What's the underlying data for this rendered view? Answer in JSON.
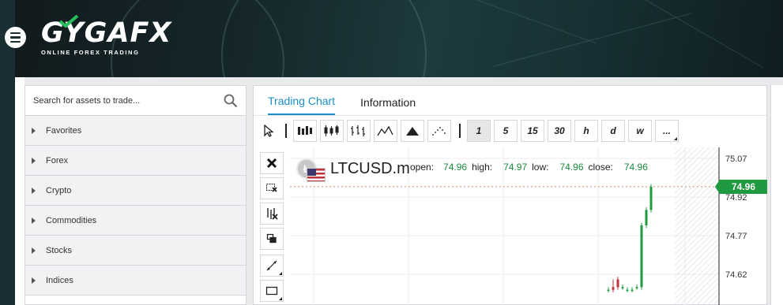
{
  "brand": {
    "name_part1": "GYGA",
    "name_part2": "FX",
    "tagline": "ONLINE FOREX TRADING"
  },
  "search": {
    "placeholder": "Search for assets to trade..."
  },
  "categories": [
    {
      "label": "Favorites"
    },
    {
      "label": "Forex"
    },
    {
      "label": "Crypto"
    },
    {
      "label": "Commodities"
    },
    {
      "label": "Stocks"
    },
    {
      "label": "Indices"
    }
  ],
  "tabs": [
    {
      "label": "Trading Chart",
      "active": true
    },
    {
      "label": "Information",
      "active": false
    }
  ],
  "toolbar": {
    "chart_types": [
      "bars-icon",
      "candles-icon",
      "hollow-candles-icon",
      "line-icon",
      "area-icon",
      "dots-icon"
    ],
    "timeframes": [
      "1",
      "5",
      "15",
      "30",
      "h",
      "d",
      "w",
      "..."
    ],
    "selected_timeframe": "1"
  },
  "left_tools": [
    "cursor-icon",
    "remove-icon",
    "select-remove-icon",
    "delete-all-icon",
    "clone-icon",
    "trendline-icon",
    "rectangle-icon"
  ],
  "symbol": {
    "name": "LTCUSD.m",
    "coin_letter": "Ł"
  },
  "ohlc": {
    "open_label": "open:",
    "open": "74.96",
    "high_label": "high:",
    "high": "74.97",
    "low_label": "low:",
    "low": "74.96",
    "close_label": "close:",
    "close": "74.96"
  },
  "chart_data": {
    "type": "candlestick",
    "y_ticks": [
      "75.07",
      "74.92",
      "74.77",
      "74.62"
    ],
    "last_price": "74.96",
    "candles": [
      {
        "open": 74.56,
        "high": 74.57,
        "low": 74.55,
        "close": 74.56
      },
      {
        "open": 74.57,
        "high": 74.6,
        "low": 74.55,
        "close": 74.56
      },
      {
        "open": 74.6,
        "high": 74.61,
        "low": 74.56,
        "close": 74.57
      },
      {
        "open": 74.57,
        "high": 74.58,
        "low": 74.56,
        "close": 74.57
      },
      {
        "open": 74.56,
        "high": 74.57,
        "low": 74.55,
        "close": 74.56
      },
      {
        "open": 74.56,
        "high": 74.57,
        "low": 74.55,
        "close": 74.56
      },
      {
        "open": 74.57,
        "high": 74.58,
        "low": 74.56,
        "close": 74.57
      },
      {
        "open": 74.57,
        "high": 74.82,
        "low": 74.56,
        "close": 74.81
      },
      {
        "open": 74.81,
        "high": 74.88,
        "low": 74.8,
        "close": 74.87
      },
      {
        "open": 74.87,
        "high": 74.97,
        "low": 74.86,
        "close": 74.96
      }
    ],
    "colors": {
      "up": "#1f9a41",
      "down": "#c0333b"
    }
  }
}
